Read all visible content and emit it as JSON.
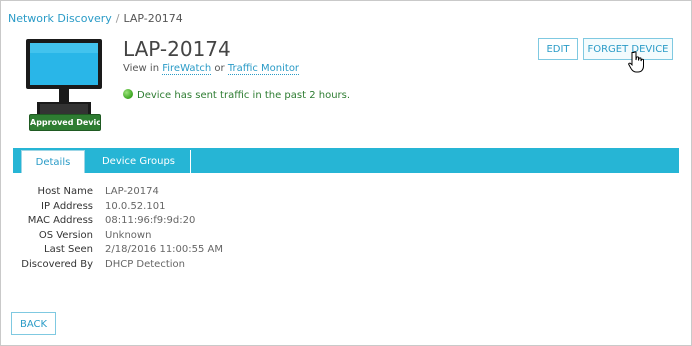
{
  "breadcrumb": {
    "parent": "Network Discovery",
    "separator": "/",
    "current": "LAP-20174"
  },
  "device": {
    "title": "LAP-20174",
    "badge": "Approved Device",
    "icon": "desktop-computer-icon",
    "view_in_prefix": "View in",
    "view_in_link1": "FireWatch",
    "view_in_or": "or",
    "view_in_link2": "Traffic Monitor",
    "status_text": "Device has sent traffic in the past 2 hours.",
    "status_color": "#2e7d32"
  },
  "actions": {
    "edit_label": "EDIT",
    "forget_label": "FORGET DEVICE"
  },
  "tabs": [
    {
      "label": "Details",
      "active": true
    },
    {
      "label": "Device Groups",
      "active": false
    }
  ],
  "details": [
    {
      "label": "Host Name",
      "value": "LAP-20174"
    },
    {
      "label": "IP Address",
      "value": "10.0.52.101"
    },
    {
      "label": "MAC Address",
      "value": "08:11:96:f9:9d:20"
    },
    {
      "label": "OS Version",
      "value": "Unknown"
    },
    {
      "label": "Last Seen",
      "value": "2/18/2016 11:00:55 AM"
    },
    {
      "label": "Discovered By",
      "value": "DHCP Detection"
    }
  ],
  "footer": {
    "back_label": "BACK"
  },
  "colors": {
    "accent": "#26b5d5",
    "link": "#2a9bc7",
    "badge": "#2e7d32"
  }
}
